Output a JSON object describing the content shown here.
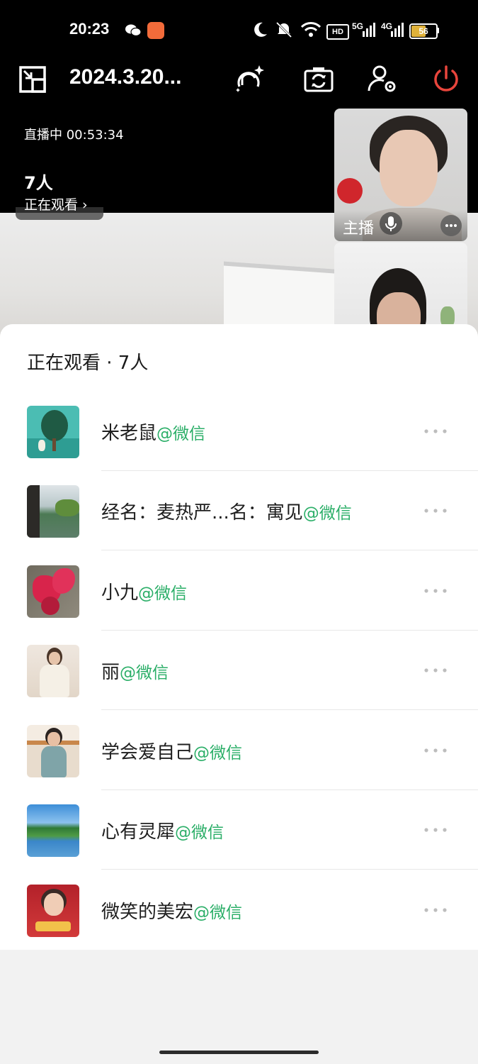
{
  "status_bar": {
    "time": "20:23",
    "battery": "56",
    "network_1": "5G",
    "network_2": "4G",
    "hd_badge": "HD",
    "icons": [
      "wechat-icon",
      "app-icon",
      "moon-icon",
      "mute-icon",
      "wifi-icon",
      "hd-icon",
      "signal-5g-icon",
      "signal-4g-icon",
      "battery-icon"
    ]
  },
  "toolbar": {
    "title": "2024.3.20...",
    "icons": [
      "exit-fullscreen-icon",
      "beauty-icon",
      "flip-camera-icon",
      "guest-settings-icon",
      "power-icon"
    ]
  },
  "live": {
    "status": "直播中 00:53:34",
    "viewer_count": "7人",
    "viewer_link": "正在观看 ›"
  },
  "host_thumb": {
    "label": "主播"
  },
  "sheet": {
    "title": "正在观看 · 7人",
    "viewers": [
      {
        "name": "米老鼠",
        "source": "@微信"
      },
      {
        "name": "经名：麦热严...名：寓见",
        "source": "@微信"
      },
      {
        "name": "小九",
        "source": "@微信"
      },
      {
        "name": "丽",
        "source": "@微信"
      },
      {
        "name": "学会爱自己",
        "source": "@微信"
      },
      {
        "name": "心有灵犀",
        "source": "@微信"
      },
      {
        "name": "微笑的美宏",
        "source": "@微信"
      }
    ]
  },
  "colors": {
    "accent_green": "#2aae67",
    "power_red": "#e8453c"
  }
}
